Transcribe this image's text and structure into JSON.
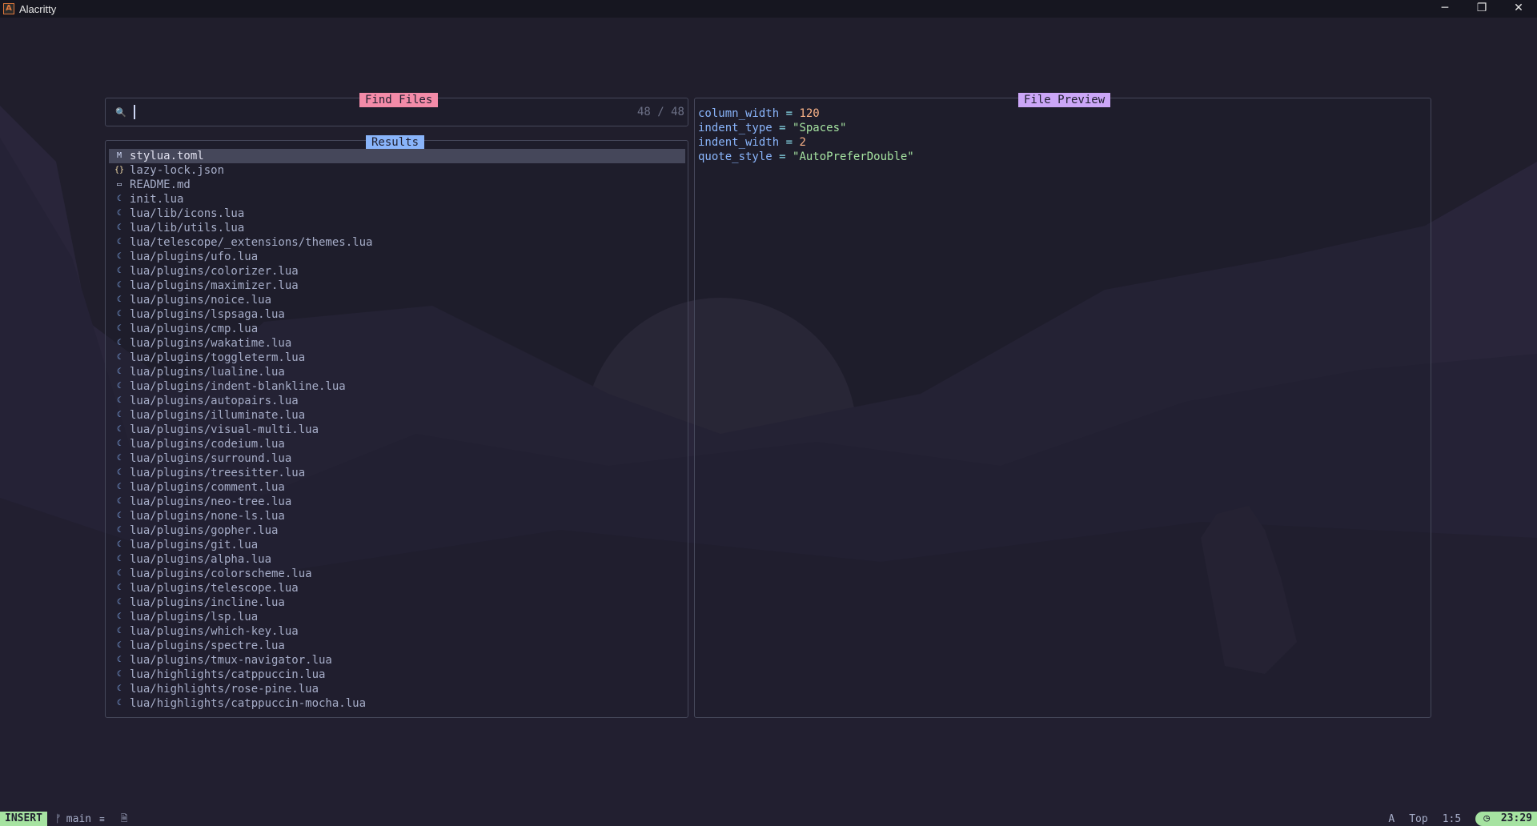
{
  "window": {
    "title": "Alacritty",
    "app_icon": "A",
    "controls": {
      "minimize": "─",
      "restore": "❐",
      "close": "✕"
    }
  },
  "prompt": {
    "title": "Find Files",
    "search_icon": "🔍",
    "count": "48 / 48"
  },
  "results": {
    "title": "Results",
    "items": [
      {
        "icon": "M",
        "icon_color": "#cdd6f4",
        "name": "stylua.toml",
        "selected": true
      },
      {
        "icon": "{}",
        "icon_color": "#f9e2af",
        "name": "lazy-lock.json"
      },
      {
        "icon": "▭",
        "icon_color": "#cdd6f4",
        "name": "README.md"
      },
      {
        "icon": "☾",
        "icon_color": "#89b4fa",
        "name": "init.lua"
      },
      {
        "icon": "☾",
        "icon_color": "#89b4fa",
        "name": "lua/lib/icons.lua"
      },
      {
        "icon": "☾",
        "icon_color": "#89b4fa",
        "name": "lua/lib/utils.lua"
      },
      {
        "icon": "☾",
        "icon_color": "#89b4fa",
        "name": "lua/telescope/_extensions/themes.lua"
      },
      {
        "icon": "☾",
        "icon_color": "#89b4fa",
        "name": "lua/plugins/ufo.lua"
      },
      {
        "icon": "☾",
        "icon_color": "#89b4fa",
        "name": "lua/plugins/colorizer.lua"
      },
      {
        "icon": "☾",
        "icon_color": "#89b4fa",
        "name": "lua/plugins/maximizer.lua"
      },
      {
        "icon": "☾",
        "icon_color": "#89b4fa",
        "name": "lua/plugins/noice.lua"
      },
      {
        "icon": "☾",
        "icon_color": "#89b4fa",
        "name": "lua/plugins/lspsaga.lua"
      },
      {
        "icon": "☾",
        "icon_color": "#89b4fa",
        "name": "lua/plugins/cmp.lua"
      },
      {
        "icon": "☾",
        "icon_color": "#89b4fa",
        "name": "lua/plugins/wakatime.lua"
      },
      {
        "icon": "☾",
        "icon_color": "#89b4fa",
        "name": "lua/plugins/toggleterm.lua"
      },
      {
        "icon": "☾",
        "icon_color": "#89b4fa",
        "name": "lua/plugins/lualine.lua"
      },
      {
        "icon": "☾",
        "icon_color": "#89b4fa",
        "name": "lua/plugins/indent-blankline.lua"
      },
      {
        "icon": "☾",
        "icon_color": "#89b4fa",
        "name": "lua/plugins/autopairs.lua"
      },
      {
        "icon": "☾",
        "icon_color": "#89b4fa",
        "name": "lua/plugins/illuminate.lua"
      },
      {
        "icon": "☾",
        "icon_color": "#89b4fa",
        "name": "lua/plugins/visual-multi.lua"
      },
      {
        "icon": "☾",
        "icon_color": "#89b4fa",
        "name": "lua/plugins/codeium.lua"
      },
      {
        "icon": "☾",
        "icon_color": "#89b4fa",
        "name": "lua/plugins/surround.lua"
      },
      {
        "icon": "☾",
        "icon_color": "#89b4fa",
        "name": "lua/plugins/treesitter.lua"
      },
      {
        "icon": "☾",
        "icon_color": "#89b4fa",
        "name": "lua/plugins/comment.lua"
      },
      {
        "icon": "☾",
        "icon_color": "#89b4fa",
        "name": "lua/plugins/neo-tree.lua"
      },
      {
        "icon": "☾",
        "icon_color": "#89b4fa",
        "name": "lua/plugins/none-ls.lua"
      },
      {
        "icon": "☾",
        "icon_color": "#89b4fa",
        "name": "lua/plugins/gopher.lua"
      },
      {
        "icon": "☾",
        "icon_color": "#89b4fa",
        "name": "lua/plugins/git.lua"
      },
      {
        "icon": "☾",
        "icon_color": "#89b4fa",
        "name": "lua/plugins/alpha.lua"
      },
      {
        "icon": "☾",
        "icon_color": "#89b4fa",
        "name": "lua/plugins/colorscheme.lua"
      },
      {
        "icon": "☾",
        "icon_color": "#89b4fa",
        "name": "lua/plugins/telescope.lua"
      },
      {
        "icon": "☾",
        "icon_color": "#89b4fa",
        "name": "lua/plugins/incline.lua"
      },
      {
        "icon": "☾",
        "icon_color": "#89b4fa",
        "name": "lua/plugins/lsp.lua"
      },
      {
        "icon": "☾",
        "icon_color": "#89b4fa",
        "name": "lua/plugins/which-key.lua"
      },
      {
        "icon": "☾",
        "icon_color": "#89b4fa",
        "name": "lua/plugins/spectre.lua"
      },
      {
        "icon": "☾",
        "icon_color": "#89b4fa",
        "name": "lua/plugins/tmux-navigator.lua"
      },
      {
        "icon": "☾",
        "icon_color": "#89b4fa",
        "name": "lua/highlights/catppuccin.lua"
      },
      {
        "icon": "☾",
        "icon_color": "#89b4fa",
        "name": "lua/highlights/rose-pine.lua"
      },
      {
        "icon": "☾",
        "icon_color": "#89b4fa",
        "name": "lua/highlights/catppuccin-mocha.lua"
      }
    ]
  },
  "preview": {
    "title": "File Preview",
    "lines": [
      {
        "key": "column_width",
        "op": " = ",
        "value": "120",
        "kind": "num"
      },
      {
        "key": "indent_type",
        "op": " = ",
        "value": "\"Spaces\"",
        "kind": "str"
      },
      {
        "key": "indent_width",
        "op": " = ",
        "value": "2",
        "kind": "num"
      },
      {
        "key": "quote_style",
        "op": " = ",
        "value": "\"AutoPreferDouble\"",
        "kind": "str"
      }
    ]
  },
  "statusline": {
    "mode": "INSERT",
    "branch_icon": "ᚠ",
    "branch": "main",
    "list_icon": "≡",
    "file_icon": "🗎",
    "encoding_indicator": "A",
    "position": "Top",
    "cursor": "1:5",
    "clock_icon": "◷",
    "time": "23:29"
  },
  "colors": {
    "find_files_title": "#f38ba8",
    "results_title": "#89b4fa",
    "preview_title": "#cba6f7",
    "mode_bg": "#a6e3a1",
    "border": "#45475a"
  }
}
